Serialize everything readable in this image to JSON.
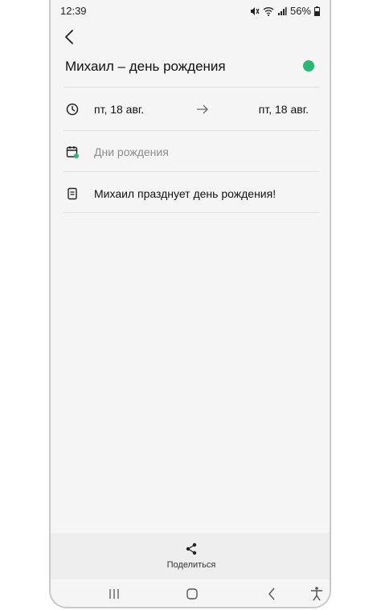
{
  "status_bar": {
    "time": "12:39",
    "battery": "56%"
  },
  "event": {
    "title": "Михаил – день рождения",
    "color": "#2bb673"
  },
  "date_row": {
    "start": "пт, 18 авг.",
    "end": "пт, 18 авг."
  },
  "calendar_row": {
    "label": "Дни рождения"
  },
  "note_row": {
    "text": "Михаил празднует день рождения!"
  },
  "bottom_bar": {
    "share_label": "Поделиться"
  },
  "icons": [
    "back-icon",
    "clock-icon",
    "arrow-right-icon",
    "calendar-icon",
    "note-icon",
    "share-icon",
    "recents-icon",
    "home-icon",
    "nav-back-icon",
    "accessibility-icon"
  ]
}
